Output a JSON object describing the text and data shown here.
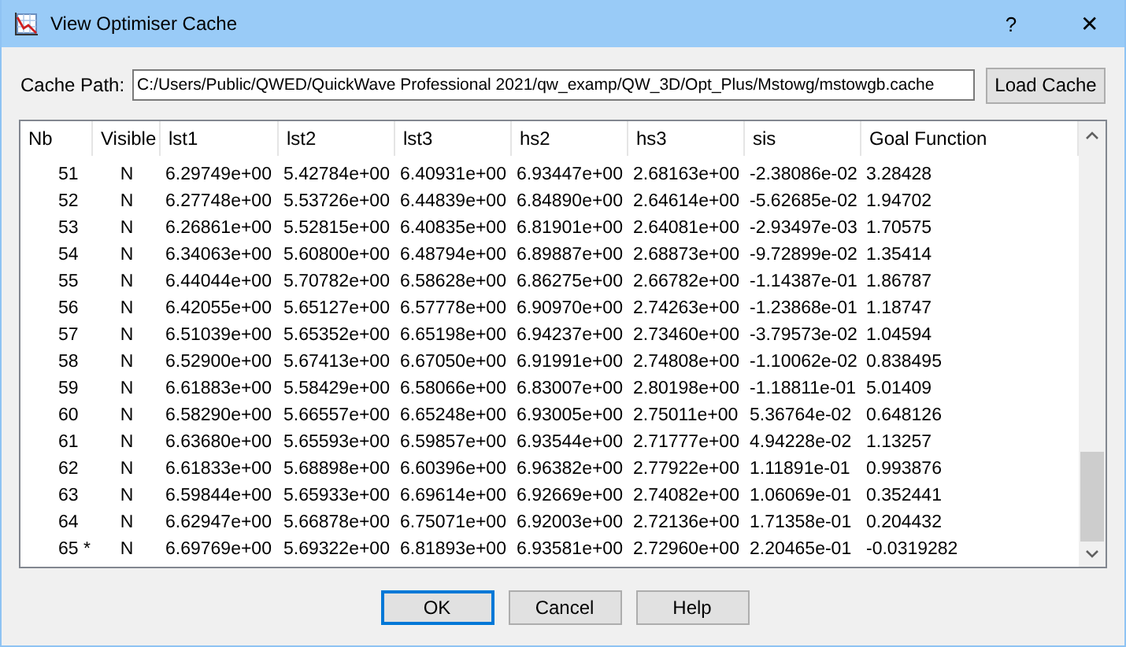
{
  "window": {
    "title": "View Optimiser Cache",
    "help_button": "?",
    "close_button": "✕"
  },
  "cache_path": {
    "label": "Cache Path:",
    "value": "C:/Users/Public/QWED/QuickWave Professional 2021/qw_examp/QW_3D/Opt_Plus/Mstowg/mstowgb.cache",
    "button": "Load Cache"
  },
  "table": {
    "columns": [
      "Nb",
      "Visible",
      "lst1",
      "lst2",
      "lst3",
      "hs2",
      "hs3",
      "sis",
      "Goal Function"
    ],
    "rows": [
      [
        "51",
        "N",
        "6.29749e+00",
        "5.42784e+00",
        "6.40931e+00",
        "6.93447e+00",
        "2.68163e+00",
        "-2.38086e-02",
        "3.28428"
      ],
      [
        "52",
        "N",
        "6.27748e+00",
        "5.53726e+00",
        "6.44839e+00",
        "6.84890e+00",
        "2.64614e+00",
        "-5.62685e-02",
        "1.94702"
      ],
      [
        "53",
        "N",
        "6.26861e+00",
        "5.52815e+00",
        "6.40835e+00",
        "6.81901e+00",
        "2.64081e+00",
        "-2.93497e-03",
        "1.70575"
      ],
      [
        "54",
        "N",
        "6.34063e+00",
        "5.60800e+00",
        "6.48794e+00",
        "6.89887e+00",
        "2.68873e+00",
        "-9.72899e-02",
        "1.35414"
      ],
      [
        "55",
        "N",
        "6.44044e+00",
        "5.70782e+00",
        "6.58628e+00",
        "6.86275e+00",
        "2.66782e+00",
        "-1.14387e-01",
        "1.86787"
      ],
      [
        "56",
        "N",
        "6.42055e+00",
        "5.65127e+00",
        "6.57778e+00",
        "6.90970e+00",
        "2.74263e+00",
        "-1.23868e-01",
        "1.18747"
      ],
      [
        "57",
        "N",
        "6.51039e+00",
        "5.65352e+00",
        "6.65198e+00",
        "6.94237e+00",
        "2.73460e+00",
        "-3.79573e-02",
        "1.04594"
      ],
      [
        "58",
        "N",
        "6.52900e+00",
        "5.67413e+00",
        "6.67050e+00",
        "6.91991e+00",
        "2.74808e+00",
        "-1.10062e-02",
        "0.838495"
      ],
      [
        "59",
        "N",
        "6.61883e+00",
        "5.58429e+00",
        "6.58066e+00",
        "6.83007e+00",
        "2.80198e+00",
        "-1.18811e-01",
        "5.01409"
      ],
      [
        "60",
        "N",
        "6.58290e+00",
        "5.66557e+00",
        "6.65248e+00",
        "6.93005e+00",
        "2.75011e+00",
        "5.36764e-02",
        "0.648126"
      ],
      [
        "61",
        "N",
        "6.63680e+00",
        "5.65593e+00",
        "6.59857e+00",
        "6.93544e+00",
        "2.71777e+00",
        "4.94228e-02",
        "1.13257"
      ],
      [
        "62",
        "N",
        "6.61833e+00",
        "5.68898e+00",
        "6.60396e+00",
        "6.96382e+00",
        "2.77922e+00",
        "1.11891e-01",
        "0.993876"
      ],
      [
        "63",
        "N",
        "6.59844e+00",
        "5.65933e+00",
        "6.69614e+00",
        "6.92669e+00",
        "2.74082e+00",
        "1.06069e-01",
        "0.352441"
      ],
      [
        "64",
        "N",
        "6.62947e+00",
        "5.66878e+00",
        "6.75071e+00",
        "6.92003e+00",
        "2.72136e+00",
        "1.71358e-01",
        "0.204432"
      ],
      [
        "65 *",
        "N",
        "6.69769e+00",
        "5.69322e+00",
        "6.81893e+00",
        "6.93581e+00",
        "2.72960e+00",
        "2.20465e-01",
        "-0.0319282"
      ]
    ]
  },
  "buttons": [
    {
      "label": "OK",
      "selected": true
    },
    {
      "label": "Cancel",
      "selected": false
    },
    {
      "label": "Help",
      "selected": false
    }
  ]
}
